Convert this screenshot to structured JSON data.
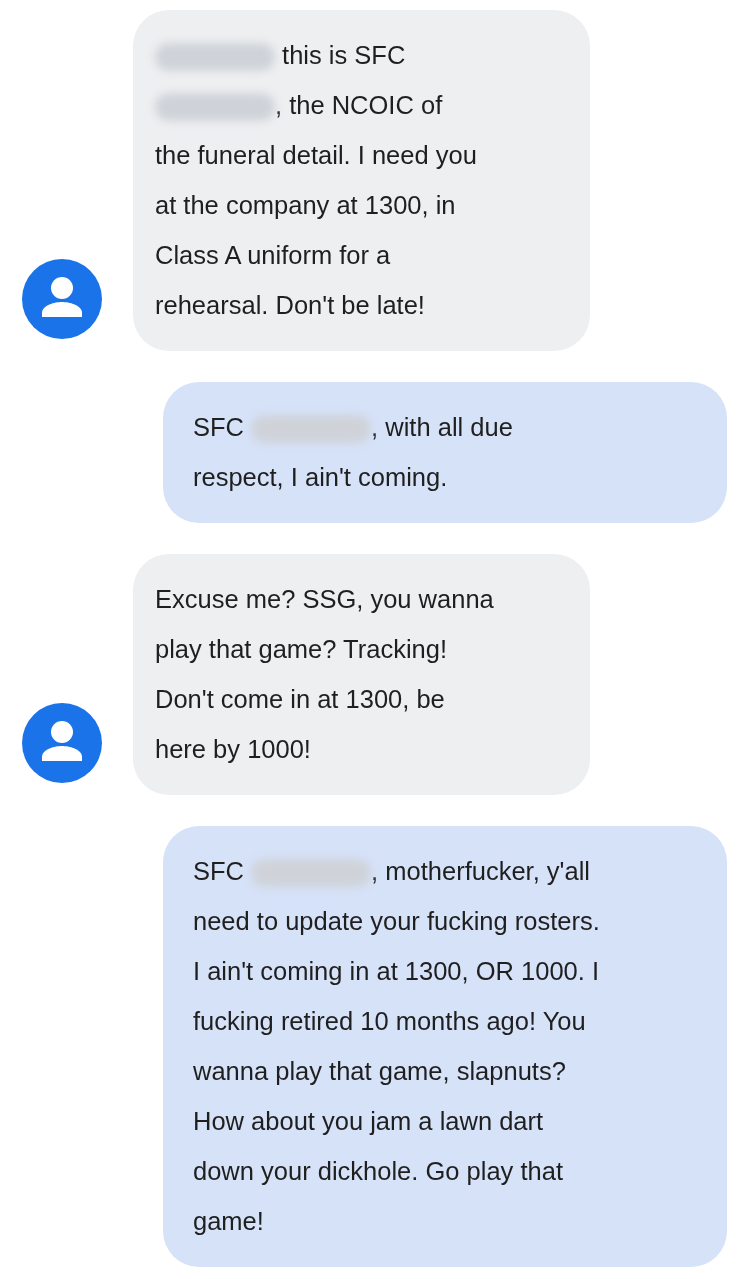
{
  "messages": [
    {
      "kind": "received",
      "lines": [
        [
          {
            "kind": "redaction"
          },
          {
            "kind": "text",
            "text": " this is SFC"
          }
        ],
        [
          {
            "kind": "redaction"
          },
          {
            "kind": "text",
            "text": ", the NCOIC of"
          }
        ],
        [
          {
            "kind": "text",
            "text": "the funeral detail. I need you"
          }
        ],
        [
          {
            "kind": "text",
            "text": "at the company at 1300, in"
          }
        ],
        [
          {
            "kind": "text",
            "text": "Class A uniform for a"
          }
        ],
        [
          {
            "kind": "text",
            "text": "rehearsal. Don't be late!"
          }
        ]
      ]
    },
    {
      "kind": "sent",
      "lines": [
        [
          {
            "kind": "text",
            "text": "SFC "
          },
          {
            "kind": "redaction"
          },
          {
            "kind": "text",
            "text": ", with all due"
          }
        ],
        [
          {
            "kind": "text",
            "text": "respect, I ain't coming."
          }
        ]
      ]
    },
    {
      "kind": "received",
      "lines": [
        [
          {
            "kind": "text",
            "text": "Excuse me? SSG, you wanna"
          }
        ],
        [
          {
            "kind": "text",
            "text": "play that game? Tracking!"
          }
        ],
        [
          {
            "kind": "text",
            "text": "Don't come in at 1300, be"
          }
        ],
        [
          {
            "kind": "text",
            "text": "here by 1000!"
          }
        ]
      ]
    },
    {
      "kind": "sent",
      "lines": [
        [
          {
            "kind": "text",
            "text": "SFC "
          },
          {
            "kind": "redaction"
          },
          {
            "kind": "text",
            "text": ", motherfucker, y'all"
          }
        ],
        [
          {
            "kind": "text",
            "text": "need to update your fucking rosters."
          }
        ],
        [
          {
            "kind": "text",
            "text": "I ain't coming in at 1300, OR 1000. I"
          }
        ],
        [
          {
            "kind": "text",
            "text": "fucking retired 10 months ago! You"
          }
        ],
        [
          {
            "kind": "text",
            "text": "wanna play that game, slapnuts?"
          }
        ],
        [
          {
            "kind": "text",
            "text": "How about you jam a lawn dart"
          }
        ],
        [
          {
            "kind": "text",
            "text": "down your dickhole. Go play that"
          }
        ],
        [
          {
            "kind": "text",
            "text": "game!"
          }
        ]
      ]
    }
  ]
}
